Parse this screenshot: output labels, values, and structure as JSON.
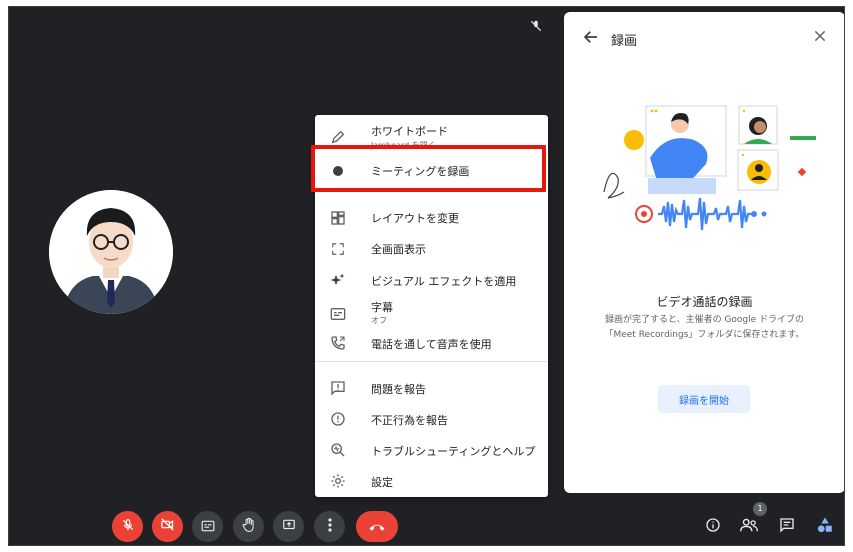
{
  "menu": {
    "items": [
      {
        "label": "ホワイトボード",
        "sub": "Jamboard を開く",
        "icon": "pen-icon"
      },
      {
        "label": "ミーティングを録画",
        "icon": "record-dot-icon"
      },
      {
        "label": "レイアウトを変更",
        "icon": "layout-icon"
      },
      {
        "label": "全画面表示",
        "icon": "fullscreen-icon"
      },
      {
        "label": "ビジュアル エフェクトを適用",
        "icon": "sparkle-icon"
      },
      {
        "label": "字幕",
        "sub": "オフ",
        "icon": "captions-icon"
      },
      {
        "label": "電話を通して音声を使用",
        "icon": "phone-icon"
      },
      {
        "label": "問題を報告",
        "icon": "feedback-icon"
      },
      {
        "label": "不正行為を報告",
        "icon": "alert-icon"
      },
      {
        "label": "トラブルシューティングとヘルプ",
        "icon": "troubleshoot-icon"
      },
      {
        "label": "設定",
        "icon": "gear-icon"
      }
    ]
  },
  "panel": {
    "title": "録画",
    "heading": "ビデオ通話の録画",
    "description": "録画が完了すると、主催者の Google ドライブの「Meet Recordings」フォルダに保存されます。",
    "start_button": "録画を開始"
  },
  "toolbar": {
    "participant_count": "1"
  },
  "colors": {
    "accent": "#1a73e8",
    "danger": "#ea4335",
    "highlight": "#e8170d",
    "background": "#202124"
  }
}
